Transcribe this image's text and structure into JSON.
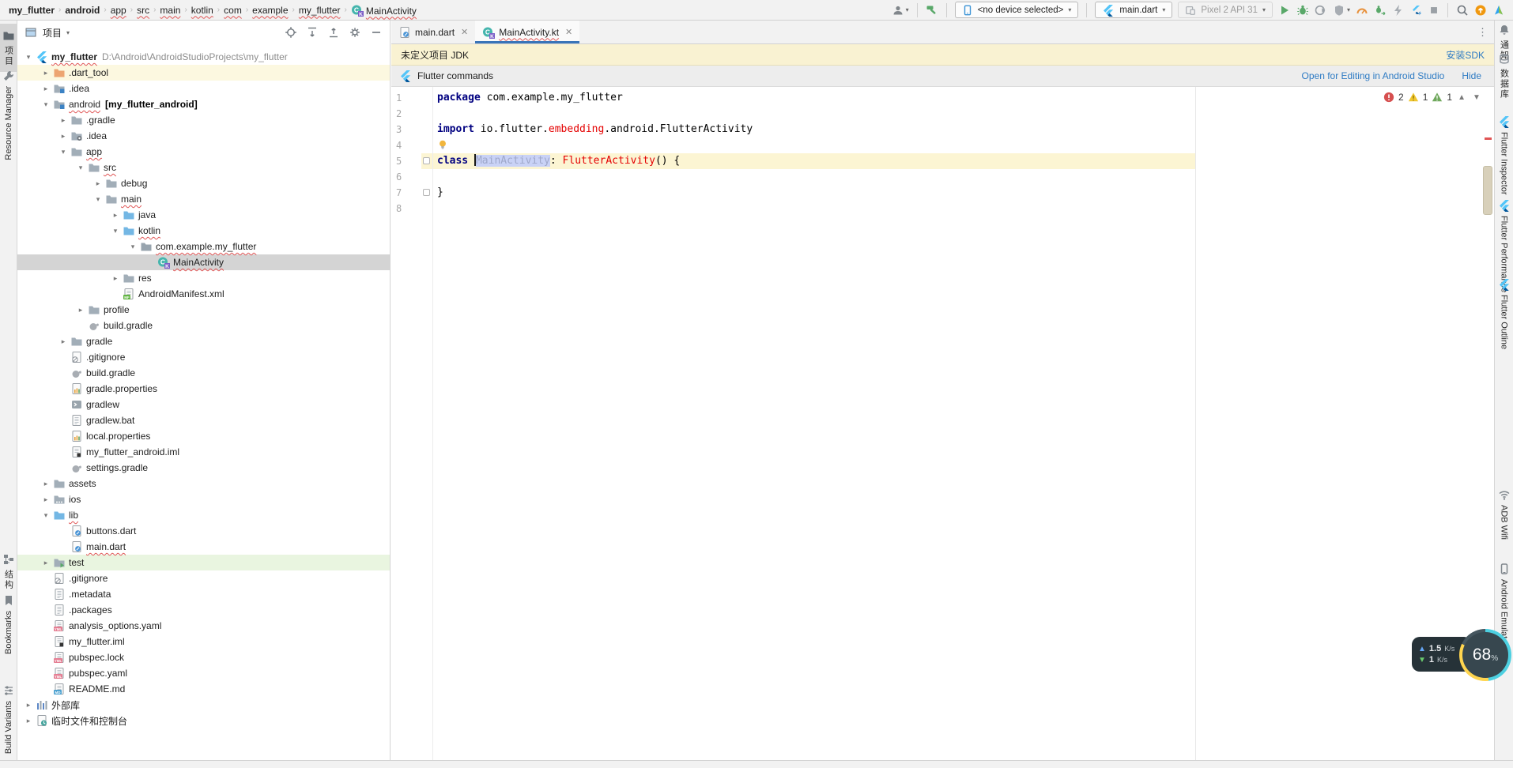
{
  "breadcrumbs": {
    "items": [
      {
        "label": "my_flutter",
        "bold": true
      },
      {
        "label": "android",
        "bold": true
      },
      {
        "label": "app",
        "error": true
      },
      {
        "label": "src",
        "error": true
      },
      {
        "label": "main",
        "error": true
      },
      {
        "label": "kotlin",
        "error": true
      },
      {
        "label": "com",
        "error": true
      },
      {
        "label": "example",
        "error": true
      },
      {
        "label": "my_flutter",
        "error": true
      },
      {
        "label": "MainActivity",
        "error": true,
        "icon": "kotlin-class"
      }
    ],
    "separator": "›"
  },
  "toolbar": {
    "device_selector": "<no device selected>",
    "run_config": "main.dart",
    "deploy_target": "Pixel 2 API 31"
  },
  "left_strip": {
    "items": [
      {
        "label": "项目",
        "icon": "toolwin-project",
        "active": true
      },
      {
        "label": "Resource Manager",
        "icon": "wrench"
      },
      {
        "label": "结构",
        "icon": "structure"
      },
      {
        "label": "Bookmarks",
        "icon": "bookmark"
      },
      {
        "label": "Build Variants",
        "icon": "variants"
      }
    ]
  },
  "right_strip": {
    "items": [
      {
        "label": "通知",
        "icon": "bell"
      },
      {
        "label": "数据库",
        "icon": "database"
      },
      {
        "label": "Flutter Inspector",
        "icon": "flutter"
      },
      {
        "label": "Flutter Performance",
        "icon": "flutter"
      },
      {
        "label": "Flutter Outline",
        "icon": "flutter"
      },
      {
        "label": "ADB Wifi",
        "icon": "wifi"
      },
      {
        "label": "Android Emulator",
        "icon": "emulator"
      }
    ]
  },
  "project_panel": {
    "title": "项目",
    "tree": [
      {
        "label": "my_flutter",
        "depth": 0,
        "icon": "flutter",
        "chevron": "v",
        "bold": true,
        "error": true,
        "note": "D:\\Android\\AndroidStudioProjects\\my_flutter"
      },
      {
        "label": ".dart_tool",
        "depth": 1,
        "icon": "folder-orange",
        "chevron": ">",
        "highlight": "row-yellow"
      },
      {
        "label": ".idea",
        "depth": 1,
        "icon": "folder-idea",
        "chevron": ">"
      },
      {
        "label": "android",
        "depth": 1,
        "icon": "folder-android",
        "chevron": "v",
        "error": true,
        "note": "[my_flutter_android]",
        "note_bold": true
      },
      {
        "label": ".gradle",
        "depth": 2,
        "icon": "folder",
        "chevron": ">"
      },
      {
        "label": ".idea",
        "depth": 2,
        "icon": "folder-gear",
        "chevron": ">"
      },
      {
        "label": "app",
        "depth": 2,
        "icon": "folder",
        "chevron": "v",
        "error": true
      },
      {
        "label": "src",
        "depth": 3,
        "icon": "folder",
        "chevron": "v",
        "error": true
      },
      {
        "label": "debug",
        "depth": 4,
        "icon": "folder",
        "chevron": ">"
      },
      {
        "label": "main",
        "depth": 4,
        "icon": "folder",
        "chevron": "v",
        "error": true
      },
      {
        "label": "java",
        "depth": 5,
        "icon": "folder-blue",
        "chevron": ">"
      },
      {
        "label": "kotlin",
        "depth": 5,
        "icon": "folder-blue",
        "chevron": "v",
        "error": true
      },
      {
        "label": "com.example.my_flutter",
        "depth": 6,
        "icon": "folder-package",
        "chevron": "v",
        "error": true
      },
      {
        "label": "MainActivity",
        "depth": 7,
        "icon": "kotlin-class",
        "highlight": "row-selected",
        "error": true
      },
      {
        "label": "res",
        "depth": 5,
        "icon": "folder",
        "chevron": ">"
      },
      {
        "label": "AndroidManifest.xml",
        "depth": 5,
        "icon": "file-manifest"
      },
      {
        "label": "profile",
        "depth": 3,
        "icon": "folder",
        "chevron": ">"
      },
      {
        "label": "build.gradle",
        "depth": 3,
        "icon": "file-gradle"
      },
      {
        "label": "gradle",
        "depth": 2,
        "icon": "folder",
        "chevron": ">"
      },
      {
        "label": ".gitignore",
        "depth": 2,
        "icon": "file-git"
      },
      {
        "label": "build.gradle",
        "depth": 2,
        "icon": "file-gradle"
      },
      {
        "label": "gradle.properties",
        "depth": 2,
        "icon": "file-props"
      },
      {
        "label": "gradlew",
        "depth": 2,
        "icon": "file-exec"
      },
      {
        "label": "gradlew.bat",
        "depth": 2,
        "icon": "file-text"
      },
      {
        "label": "local.properties",
        "depth": 2,
        "icon": "file-props"
      },
      {
        "label": "my_flutter_android.iml",
        "depth": 2,
        "icon": "file-iml"
      },
      {
        "label": "settings.gradle",
        "depth": 2,
        "icon": "file-gradle"
      },
      {
        "label": "assets",
        "depth": 1,
        "icon": "folder",
        "chevron": ">"
      },
      {
        "label": "ios",
        "depth": 1,
        "icon": "folder-ios",
        "chevron": ">"
      },
      {
        "label": "lib",
        "depth": 1,
        "icon": "folder-blue",
        "chevron": "v",
        "error": true
      },
      {
        "label": "buttons.dart",
        "depth": 2,
        "icon": "file-dart"
      },
      {
        "label": "main.dart",
        "depth": 2,
        "icon": "file-dart",
        "error": true
      },
      {
        "label": "test",
        "depth": 1,
        "icon": "folder-test",
        "chevron": ">",
        "highlight": "row-green"
      },
      {
        "label": ".gitignore",
        "depth": 1,
        "icon": "file-git"
      },
      {
        "label": ".metadata",
        "depth": 1,
        "icon": "file-text"
      },
      {
        "label": ".packages",
        "depth": 1,
        "icon": "file-text"
      },
      {
        "label": "analysis_options.yaml",
        "depth": 1,
        "icon": "file-yml"
      },
      {
        "label": "my_flutter.iml",
        "depth": 1,
        "icon": "file-iml"
      },
      {
        "label": "pubspec.lock",
        "depth": 1,
        "icon": "file-yml"
      },
      {
        "label": "pubspec.yaml",
        "depth": 1,
        "icon": "file-yml"
      },
      {
        "label": "README.md",
        "depth": 1,
        "icon": "file-md"
      },
      {
        "label": "外部库",
        "depth": 0,
        "icon": "ext-lib",
        "chevron": ">"
      },
      {
        "label": "临时文件和控制台",
        "depth": 0,
        "icon": "scratch",
        "chevron": ">"
      }
    ]
  },
  "editor": {
    "tabs": [
      {
        "label": "main.dart",
        "icon": "file-dart"
      },
      {
        "label": "MainActivity.kt",
        "icon": "kotlin-class",
        "active": true,
        "error": true
      }
    ],
    "notifications": {
      "jdk": {
        "text": "未定义项目 JDK",
        "action": "安装SDK"
      },
      "flutter": {
        "text": "Flutter commands",
        "action_primary": "Open for Editing in Android Studio",
        "action_secondary": "Hide"
      }
    },
    "inspections": {
      "errors": "2",
      "warnings": "1",
      "weak_warnings": "1"
    },
    "lines": [
      {
        "n": "1",
        "tokens": [
          {
            "t": "package",
            "c": "kw"
          },
          {
            "t": " com.example.my_flutter",
            "c": "pl"
          }
        ]
      },
      {
        "n": "2",
        "tokens": []
      },
      {
        "n": "3",
        "tokens": [
          {
            "t": "import",
            "c": "kw"
          },
          {
            "t": " io.flutter.",
            "c": "pl"
          },
          {
            "t": "embedding",
            "c": "errt"
          },
          {
            "t": ".android.FlutterActivity",
            "c": "pl"
          }
        ]
      },
      {
        "n": "4",
        "tokens": [],
        "bulb": true
      },
      {
        "n": "5",
        "tokens": [
          {
            "t": "class ",
            "c": "kw"
          },
          {
            "t": "MainActivity",
            "c": "selt",
            "caret_before": true
          },
          {
            "t": ": ",
            "c": "pl"
          },
          {
            "t": "FlutterActivity",
            "c": "errt"
          },
          {
            "t": "() {",
            "c": "pl"
          }
        ],
        "current": true,
        "fold": true
      },
      {
        "n": "6",
        "tokens": []
      },
      {
        "n": "7",
        "tokens": [
          {
            "t": "}",
            "c": "pl"
          }
        ],
        "fold": true
      },
      {
        "n": "8",
        "tokens": []
      }
    ]
  },
  "overlay": {
    "upload": "1.5",
    "upload_unit": "K/s",
    "download": "1",
    "download_unit": "K/s",
    "percent": "68",
    "percent_unit": "%"
  }
}
